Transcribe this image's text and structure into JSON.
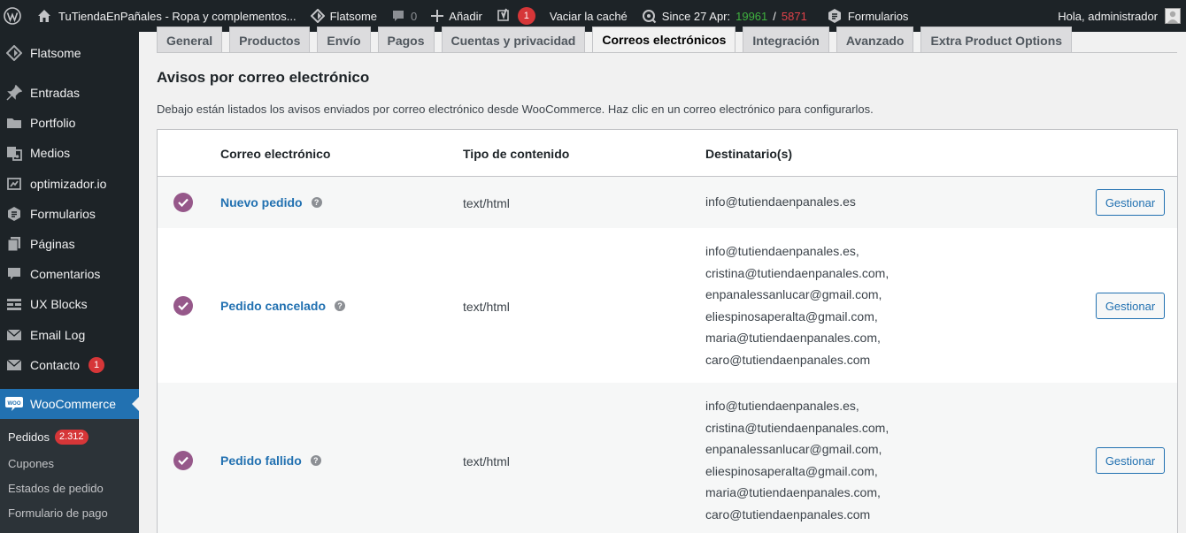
{
  "adminbar": {
    "site_name": "TuTiendaEnPañales - Ropa y complementos...",
    "theme": "Flatsome",
    "comments_count": "0",
    "add_new": "Añadir",
    "yoast_count": "1",
    "clear_cache": "Vaciar la caché",
    "since_label": "Since 27 Apr:",
    "stat_green": "19961",
    "stat_sep": "/",
    "stat_red": "5871",
    "forms": "Formularios",
    "greeting": "Hola, administrador"
  },
  "sidebar": {
    "items": [
      {
        "label": "Flatsome",
        "icon": "flatsome-icon"
      },
      {
        "label": "Entradas",
        "icon": "pin-icon"
      },
      {
        "label": "Portfolio",
        "icon": "folder-icon"
      },
      {
        "label": "Medios",
        "icon": "media-icon"
      },
      {
        "label": "optimizador.io",
        "icon": "optimizer-icon"
      },
      {
        "label": "Formularios",
        "icon": "forms-icon"
      },
      {
        "label": "Páginas",
        "icon": "pages-icon"
      },
      {
        "label": "Comentarios",
        "icon": "comment-icon"
      },
      {
        "label": "UX Blocks",
        "icon": "blocks-icon"
      },
      {
        "label": "Email Log",
        "icon": "email-icon"
      },
      {
        "label": "Contacto",
        "icon": "contact-icon",
        "badge": "1"
      },
      {
        "label": "WooCommerce",
        "icon": "woocommerce-icon"
      }
    ],
    "submenu": [
      {
        "label": "Pedidos",
        "badge": "2.312"
      },
      {
        "label": "Cupones"
      },
      {
        "label": "Estados de pedido"
      },
      {
        "label": "Formulario de pago"
      }
    ]
  },
  "tabs": [
    "General",
    "Productos",
    "Envío",
    "Pagos",
    "Cuentas y privacidad",
    "Correos electrónicos",
    "Integración",
    "Avanzado",
    "Extra Product Options"
  ],
  "active_tab": "Correos electrónicos",
  "main": {
    "title": "Avisos por correo electrónico",
    "description": "Debajo están listados los avisos enviados por correo electrónico desde WooCommerce. Haz clic en un correo electrónico para configurarlos."
  },
  "table": {
    "headers": [
      "Correo electrónico",
      "Tipo de contenido",
      "Destinatario(s)"
    ],
    "rows": [
      {
        "name": "Nuevo pedido",
        "content_type": "text/html",
        "recipients": [
          "info@tutiendaenpanales.es"
        ],
        "action": "Gestionar"
      },
      {
        "name": "Pedido cancelado",
        "content_type": "text/html",
        "recipients": [
          "info@tutiendaenpanales.es,",
          "cristina@tutiendaenpanales.com,",
          "enpanalessanlucar@gmail.com,",
          "eliespinosaperalta@gmail.com,",
          "maria@tutiendaenpanales.com,",
          "caro@tutiendaenpanales.com"
        ],
        "action": "Gestionar"
      },
      {
        "name": "Pedido fallido",
        "content_type": "text/html",
        "recipients": [
          "info@tutiendaenpanales.es,",
          "cristina@tutiendaenpanales.com,",
          "enpanalessanlucar@gmail.com,",
          "eliespinosaperalta@gmail.com,",
          "maria@tutiendaenpanales.com,",
          "caro@tutiendaenpanales.com"
        ],
        "action": "Gestionar"
      }
    ]
  },
  "colors": {
    "adminbar_bg": "#1d2327",
    "menu_active": "#2271b1",
    "link": "#2271b1",
    "woo_purple": "#96588a",
    "badge": "#d63638"
  }
}
